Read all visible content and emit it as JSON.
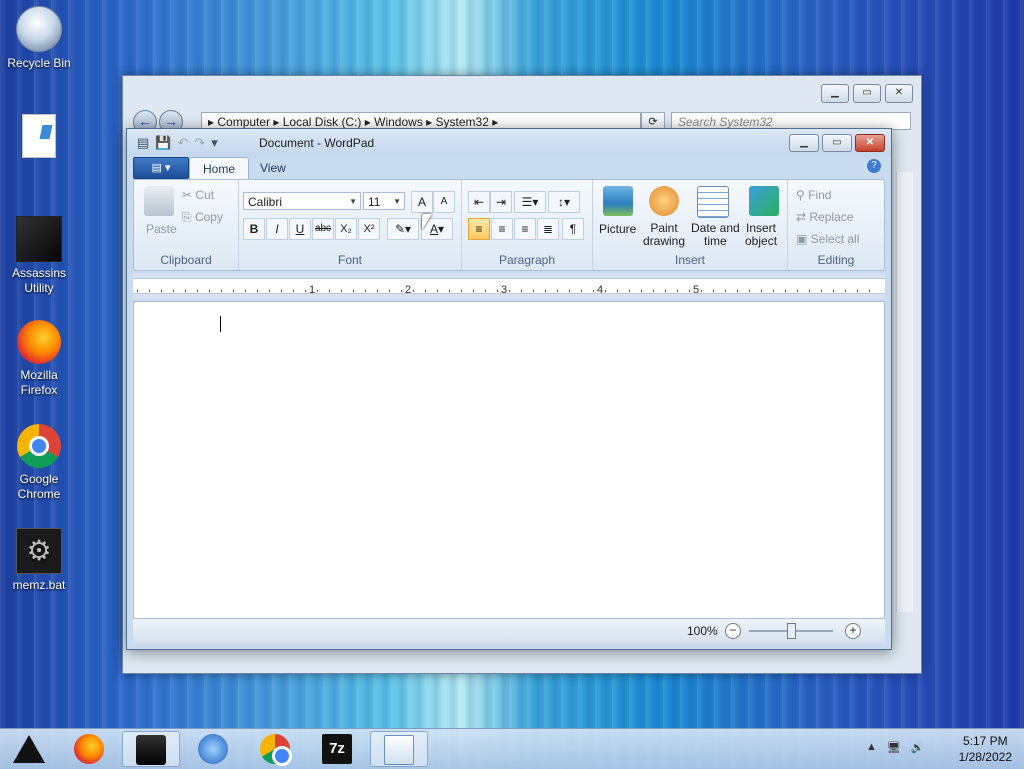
{
  "desktop": {
    "icons": [
      {
        "label": "Recycle Bin",
        "icon": "recycle-bin-icon"
      },
      {
        "label": "",
        "icon": "document-file-icon"
      },
      {
        "label": "Assassins Utility",
        "icon": "assassins-utility-icon"
      },
      {
        "label": "Mozilla Firefox",
        "icon": "firefox-icon"
      },
      {
        "label": "Google Chrome",
        "icon": "chrome-icon"
      },
      {
        "label": "memz.bat",
        "icon": "batch-file-icon"
      }
    ]
  },
  "explorer": {
    "address_parts": [
      "Computer",
      "Local Disk (C:)",
      "Windows",
      "System32"
    ],
    "search_placeholder": "Search System32"
  },
  "wordpad": {
    "title": "Document - WordPad",
    "tabs": [
      "Home",
      "View"
    ],
    "clipboard": {
      "paste": "Paste",
      "cut": "Cut",
      "copy": "Copy",
      "label": "Clipboard"
    },
    "font": {
      "family": "Calibri",
      "size": "11",
      "bold": "B",
      "italic": "I",
      "underline": "U",
      "strike": "abc",
      "subscript": "X₂",
      "superscript": "X²",
      "label": "Font"
    },
    "paragraph": {
      "label": "Paragraph"
    },
    "insert": {
      "picture": "Picture",
      "paint_line1": "Paint",
      "paint_line2": "drawing",
      "datetime_line1": "Date and",
      "datetime_line2": "time",
      "object_line1": "Insert",
      "object_line2": "object",
      "label": "Insert"
    },
    "editing": {
      "find": "Find",
      "replace": "Replace",
      "select_all": "Select all",
      "label": "Editing"
    },
    "ruler_numbers": [
      "1",
      "2",
      "3",
      "4",
      "5"
    ],
    "zoom": "100%"
  },
  "taskbar": {
    "time": "5:17 PM",
    "date": "1/28/2022",
    "zip_label": "7z"
  },
  "colors": {
    "accent": "#1e4f98",
    "highlight": "#ffc95e"
  }
}
